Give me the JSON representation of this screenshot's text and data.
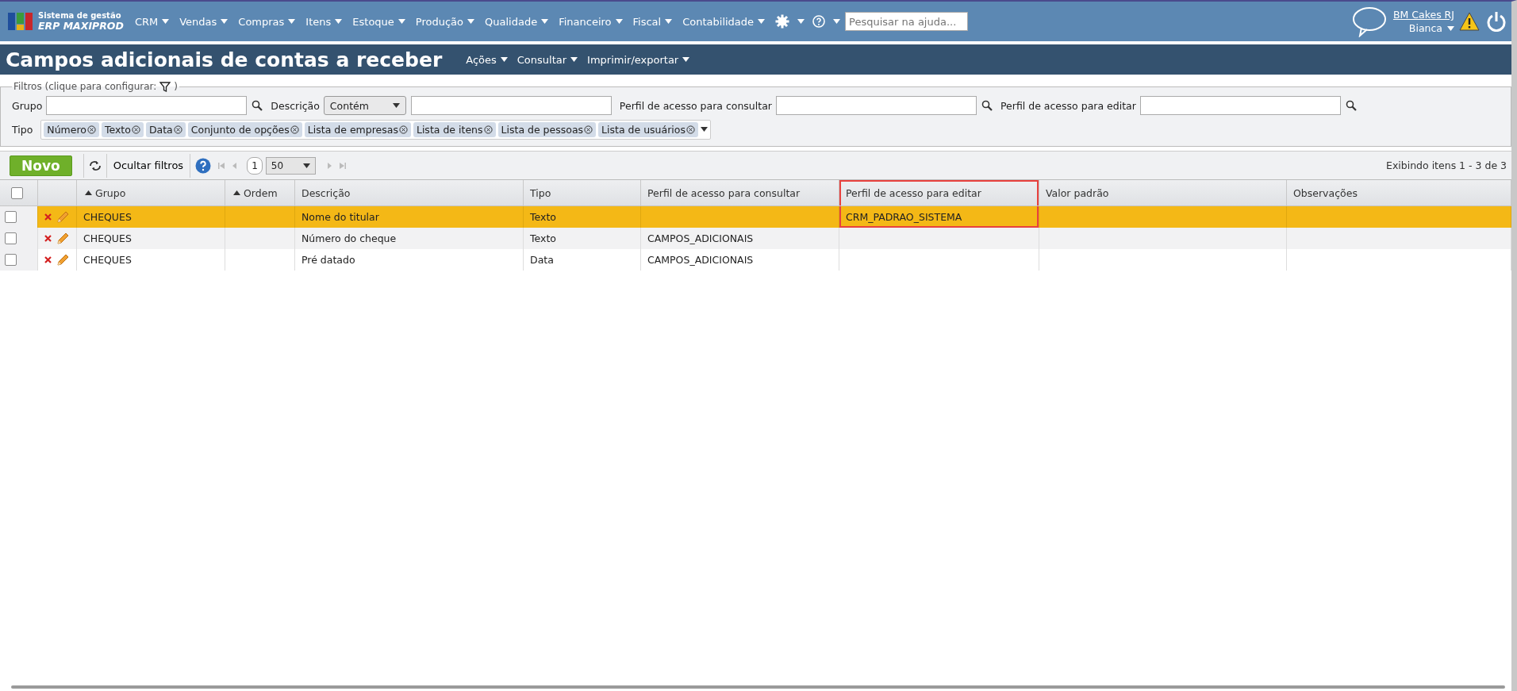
{
  "app": {
    "logo_line1": "Sistema de gestão",
    "logo_line2": "ERP MAXIPROD"
  },
  "menu": [
    "CRM",
    "Vendas",
    "Compras",
    "Itens",
    "Estoque",
    "Produção",
    "Qualidade",
    "Financeiro",
    "Fiscal",
    "Contabilidade"
  ],
  "help_search": {
    "placeholder": "Pesquisar na ajuda..."
  },
  "user": {
    "company": "BM Cakes RJ",
    "name": "Bianca"
  },
  "page": {
    "title": "Campos adicionais de contas a receber",
    "actions": [
      "Ações",
      "Consultar",
      "Imprimir/exportar"
    ]
  },
  "filters": {
    "legend": "Filtros (clique para configurar:",
    "legend_end": ")",
    "fields": [
      {
        "kind": "lookup",
        "label": "Grupo"
      },
      {
        "kind": "match",
        "label": "Descrição",
        "option": "Contém"
      },
      {
        "kind": "lookup",
        "label": "Perfil de acesso para consultar"
      },
      {
        "kind": "lookup",
        "label": "Perfil de acesso para editar"
      }
    ],
    "type_label": "Tipo",
    "type_tags": [
      "Número",
      "Texto",
      "Data",
      "Conjunto de opções",
      "Lista de empresas",
      "Lista de itens",
      "Lista de pessoas",
      "Lista de usuários"
    ]
  },
  "toolbar": {
    "new_button": "Novo",
    "hide_filters": "Ocultar filtros",
    "page": "1",
    "page_size": "50",
    "status": "Exibindo itens 1 - 3 de 3"
  },
  "table": {
    "select_all": {
      "checked": false
    },
    "columns": [
      {
        "kind": "text",
        "label": "Grupo",
        "sort_indicator": true,
        "highlighted": false
      },
      {
        "kind": "text",
        "label": "Ordem",
        "sort_indicator": true,
        "highlighted": false
      },
      {
        "kind": "text",
        "label": "Descrição",
        "sort_indicator": false,
        "highlighted": false
      },
      {
        "kind": "text",
        "label": "Tipo",
        "sort_indicator": false,
        "highlighted": false
      },
      {
        "kind": "text",
        "label": "Perfil de acesso para consultar",
        "sort_indicator": false,
        "highlighted": false
      },
      {
        "kind": "text",
        "label": "Perfil de acesso para editar",
        "sort_indicator": false,
        "highlighted": true
      },
      {
        "kind": "text",
        "label": "Valor padrão",
        "sort_indicator": false,
        "highlighted": false
      },
      {
        "kind": "text",
        "label": "Observações",
        "sort_indicator": false,
        "highlighted": false
      }
    ],
    "rows": [
      {
        "selected": true,
        "checked": false,
        "highlighted": true,
        "cells": [
          "CHEQUES",
          null,
          "Nome do titular",
          "Texto",
          null,
          "CRM_PADRAO_SISTEMA",
          null,
          null
        ]
      },
      {
        "selected": false,
        "checked": false,
        "highlighted": false,
        "cells": [
          "CHEQUES",
          null,
          "Número do cheque",
          "Texto",
          "CAMPOS_ADICIONAIS",
          null,
          null,
          null
        ]
      },
      {
        "selected": false,
        "checked": false,
        "highlighted": false,
        "cells": [
          "CHEQUES",
          null,
          "Pré datado",
          "Data",
          "CAMPOS_ADICIONAIS",
          null,
          null,
          null
        ]
      }
    ]
  }
}
